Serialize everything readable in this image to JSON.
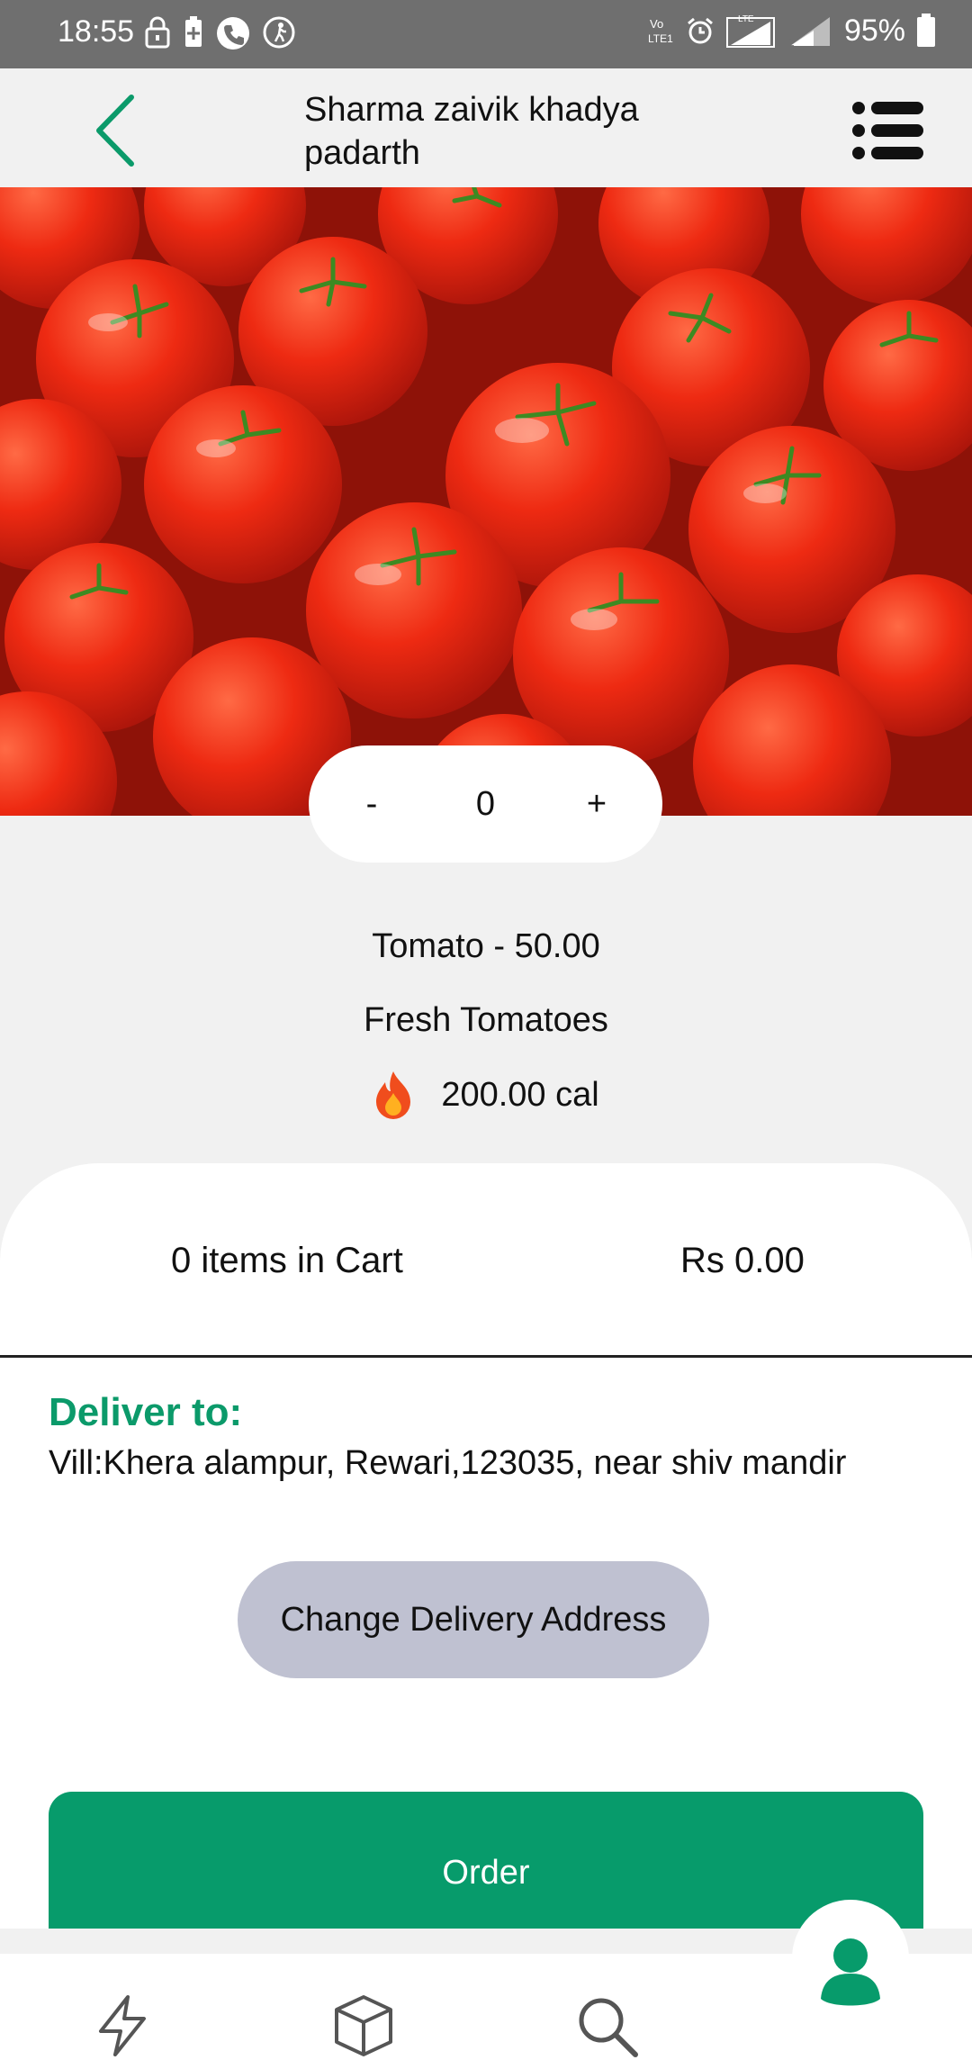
{
  "status_bar": {
    "time": "18:55",
    "battery_percent": "95%",
    "icons": [
      "lock-icon",
      "battery-saver-icon",
      "call-icon",
      "accessibility-icon",
      "volte-icon",
      "alarm-icon",
      "signal-lte-icon",
      "signal-2-icon",
      "battery-icon"
    ]
  },
  "header": {
    "title": "Sharma zaivik khadya padarth",
    "back_icon": "chevron-left-icon",
    "menu_icon": "list-menu-icon"
  },
  "product": {
    "image": "tomatoes-photo",
    "quantity": {
      "minus": "-",
      "value": "0",
      "plus": "+"
    },
    "name_price": "Tomato - 50.00",
    "description": "Fresh Tomatoes",
    "calories": "200.00 cal",
    "calorie_icon": "fire-icon"
  },
  "cart": {
    "count_text": "0 items in Cart",
    "total": "Rs 0.00"
  },
  "delivery": {
    "label": "Deliver to:",
    "address": "Vill:Khera alampur, Rewari,123035, near shiv mandir",
    "change_button": "Change Delivery Address"
  },
  "order_button": "Order",
  "bottom_nav": {
    "items": [
      "lightning-icon",
      "box-icon",
      "search-icon"
    ],
    "profile_icon": "user-icon"
  },
  "colors": {
    "accent": "#079b6b",
    "status_bar": "#6f6f6f",
    "change_button": "#bfc1d1"
  }
}
